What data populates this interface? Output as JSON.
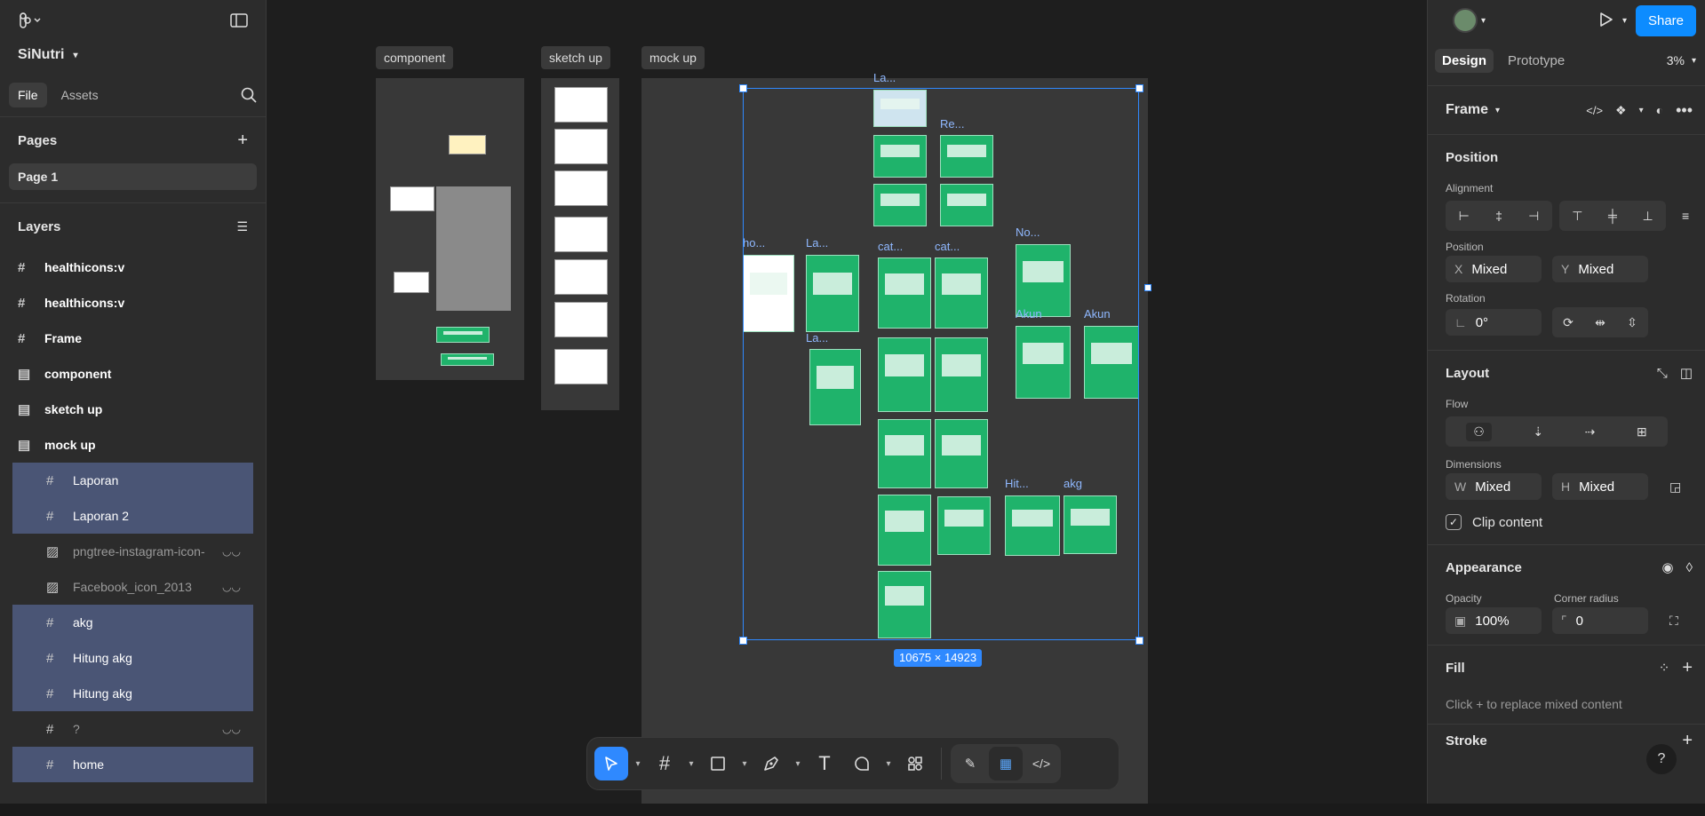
{
  "project": {
    "name": "SiNutri"
  },
  "sidebar": {
    "tabs": [
      {
        "label": "File"
      },
      {
        "label": "Assets"
      }
    ],
    "pages_title": "Pages",
    "pages": [
      {
        "label": "Page 1"
      }
    ],
    "layers_title": "Layers",
    "layers": [
      {
        "label": "healthicons:v",
        "icon": "frame-icon"
      },
      {
        "label": "healthicons:v",
        "icon": "frame-icon"
      },
      {
        "label": "Frame",
        "icon": "frame-icon"
      },
      {
        "label": "component",
        "icon": "section-icon"
      },
      {
        "label": "sketch up",
        "icon": "section-icon"
      },
      {
        "label": "mock up",
        "icon": "section-icon"
      },
      {
        "label": "Laporan",
        "icon": "frame-icon"
      },
      {
        "label": "Laporan 2",
        "icon": "frame-icon"
      },
      {
        "label": "pngtree-instagram-icon-",
        "icon": "image-icon"
      },
      {
        "label": "Facebook_icon_2013",
        "icon": "image-icon"
      },
      {
        "label": "akg",
        "icon": "frame-icon"
      },
      {
        "label": "Hitung akg",
        "icon": "frame-icon"
      },
      {
        "label": "Hitung akg",
        "icon": "frame-icon"
      },
      {
        "label": "?",
        "icon": "frame-icon"
      },
      {
        "label": "home",
        "icon": "frame-icon"
      }
    ]
  },
  "canvas": {
    "frames": [
      {
        "label": "component"
      },
      {
        "label": "sketch up"
      },
      {
        "label": "mock up"
      }
    ],
    "thumb_labels": {
      "la1": "La...",
      "re": "Re...",
      "ho": "ho...",
      "la2": "La...",
      "cat1": "cat...",
      "cat2": "cat...",
      "no": "No...",
      "akun1": "Akun",
      "akun2": "Akun",
      "la3": "La...",
      "hit": "Hit...",
      "akg": "akg"
    },
    "selection_size": "10675 × 14923"
  },
  "toolbar": {
    "tools": [
      "move-tool",
      "frame-tool",
      "shape-tool",
      "pen-tool",
      "text-tool",
      "comment-tool",
      "actions-tool"
    ]
  },
  "right_panel": {
    "share_label": "Share",
    "tabs": [
      {
        "label": "Design"
      },
      {
        "label": "Prototype"
      }
    ],
    "zoom": "3%",
    "frame_label": "Frame",
    "position": {
      "title": "Position",
      "alignment_label": "Alignment",
      "position_label": "Position",
      "x_key": "X",
      "x_value": "Mixed",
      "y_key": "Y",
      "y_value": "Mixed",
      "rotation_label": "Rotation",
      "rotation_value": "0°"
    },
    "layout": {
      "title": "Layout",
      "flow_label": "Flow",
      "dimensions_label": "Dimensions",
      "w_key": "W",
      "w_value": "Mixed",
      "h_key": "H",
      "h_value": "Mixed",
      "clip_label": "Clip content"
    },
    "appearance": {
      "title": "Appearance",
      "opacity_label": "Opacity",
      "opacity_value": "100%",
      "radius_label": "Corner radius",
      "radius_value": "0"
    },
    "fill": {
      "title": "Fill",
      "hint": "Click + to replace mixed content"
    },
    "stroke": {
      "title": "Stroke"
    }
  }
}
